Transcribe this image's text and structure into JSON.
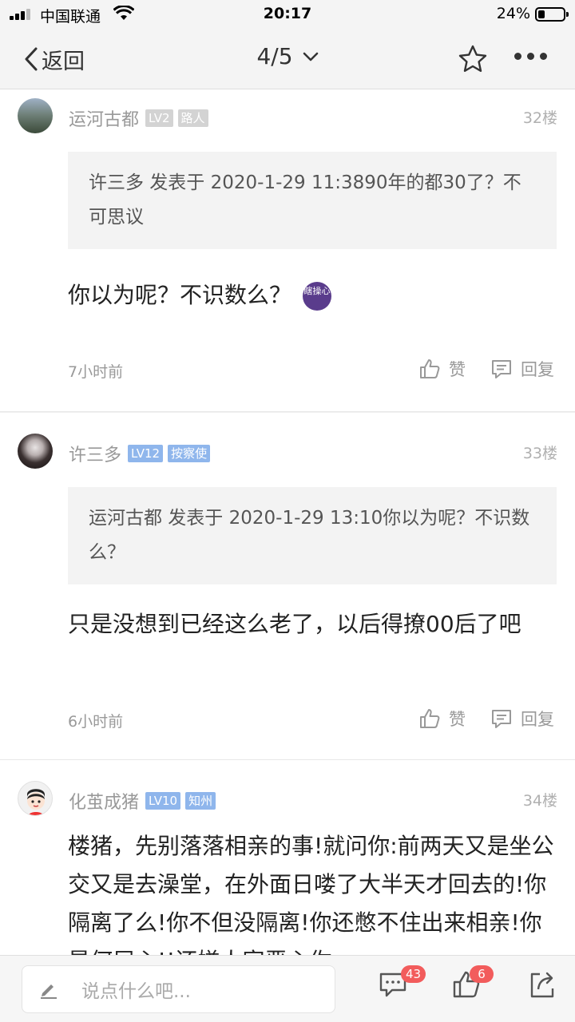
{
  "status_bar": {
    "carrier": "中国联通",
    "time": "20:17",
    "battery": "24%"
  },
  "nav": {
    "back_label": "返回",
    "page_indicator": "4/5"
  },
  "posts": [
    {
      "username": "运河古都",
      "level": "LV2",
      "title": "路人",
      "floor": "32楼",
      "quote": "许三多 发表于 2020-1-29 11:3890年的都30了？不可思议",
      "body": "你以为呢？不识数么？",
      "emoji_text": "瞎操心",
      "time": "7小时前",
      "like_label": "赞",
      "reply_label": "回复"
    },
    {
      "username": "许三多",
      "level": "LV12",
      "title": "按察使",
      "floor": "33楼",
      "quote": "运河古都 发表于 2020-1-29 13:10你以为呢？不识数么？",
      "body": "只是没想到已经这么老了，以后得撩00后了吧",
      "time": "6小时前",
      "like_label": "赞",
      "reply_label": "回复"
    },
    {
      "username": "化茧成猪",
      "level": "LV10",
      "title": "知州",
      "floor": "34楼",
      "body": "楼猪，先别落落相亲的事!就问你:前两天又是坐公交又是去澡堂，在外面日喽了大半天才回去的!你隔离了么!你不但没隔离!你还憋不住出来相亲!你是何居心!!还嫌人家恶心你"
    }
  ],
  "bottom_bar": {
    "reply_placeholder": "说点什么吧...",
    "comment_count": "43",
    "like_count": "6"
  },
  "colors": {
    "badge_blue": "#8fb6ec",
    "badge_grey": "#d3d3d3",
    "count_red": "#f25c5c"
  }
}
